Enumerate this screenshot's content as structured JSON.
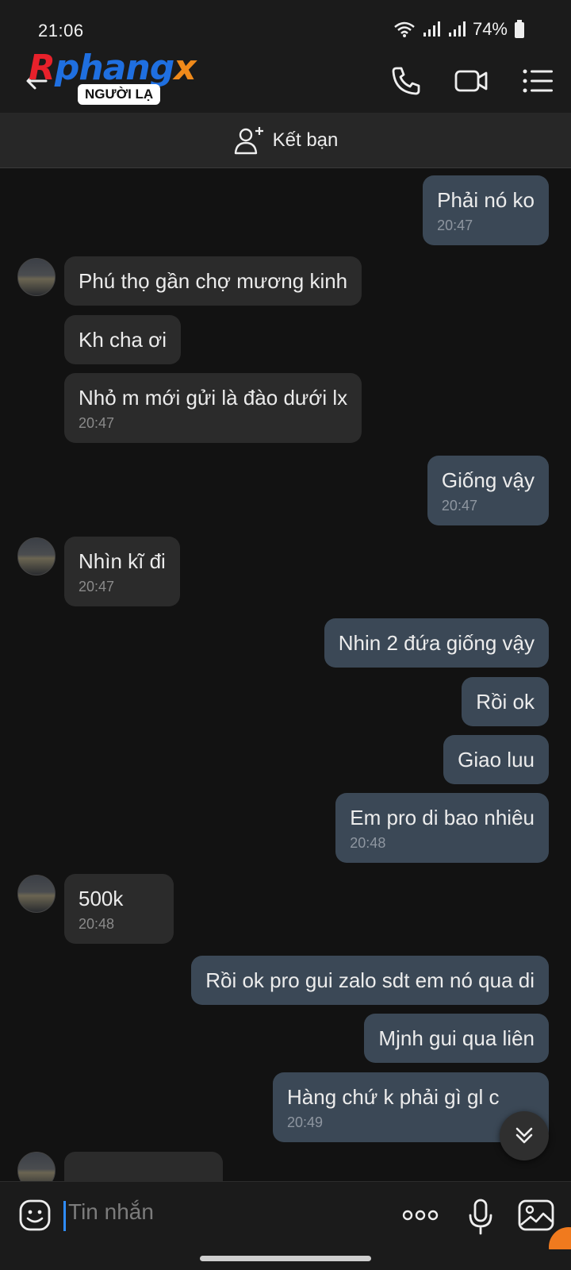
{
  "status_bar": {
    "time": "21:06",
    "battery": "74%"
  },
  "header": {
    "logo_parts": [
      "R",
      "phang",
      "x"
    ],
    "badge": "NGƯỜI LẠ",
    "icons": [
      "back-arrow-icon",
      "phone-icon",
      "video-camera-icon",
      "menu-list-icon"
    ]
  },
  "add_friend": {
    "label": "Kết bạn"
  },
  "messages": [
    {
      "side": "out",
      "text": "Phải nó ko",
      "time": "20:47"
    },
    {
      "side": "in",
      "text": "Phú thọ gần chợ mương kinh",
      "time": ""
    },
    {
      "side": "in",
      "text": "Kh cha ơi",
      "time": ""
    },
    {
      "side": "in",
      "text": " Nhỏ m mới gửi là đào dưới lx",
      "time": "20:47"
    },
    {
      "side": "out",
      "text": "Giống vậy",
      "time": "20:47"
    },
    {
      "side": "in",
      "text": "Nhìn kĩ đi",
      "time": "20:47"
    },
    {
      "side": "out",
      "text": "Nhin 2 đứa giống vậy",
      "time": ""
    },
    {
      "side": "out",
      "text": "Rồi ok",
      "time": ""
    },
    {
      "side": "out",
      "text": "Giao luu",
      "time": ""
    },
    {
      "side": "out",
      "text": "Em pro di bao nhiêu",
      "time": "20:48"
    },
    {
      "side": "in",
      "text": "500k",
      "time": "20:48"
    },
    {
      "side": "out",
      "text": "Rồi ok pro gui zalo sdt em nó qua di",
      "time": ""
    },
    {
      "side": "out",
      "text": "Mjnh gui qua liên",
      "time": ""
    },
    {
      "side": "out",
      "text": "Hàng chứ k phải gì gl c",
      "time": "20:49"
    }
  ],
  "composer": {
    "placeholder": "Tin nhắn"
  }
}
